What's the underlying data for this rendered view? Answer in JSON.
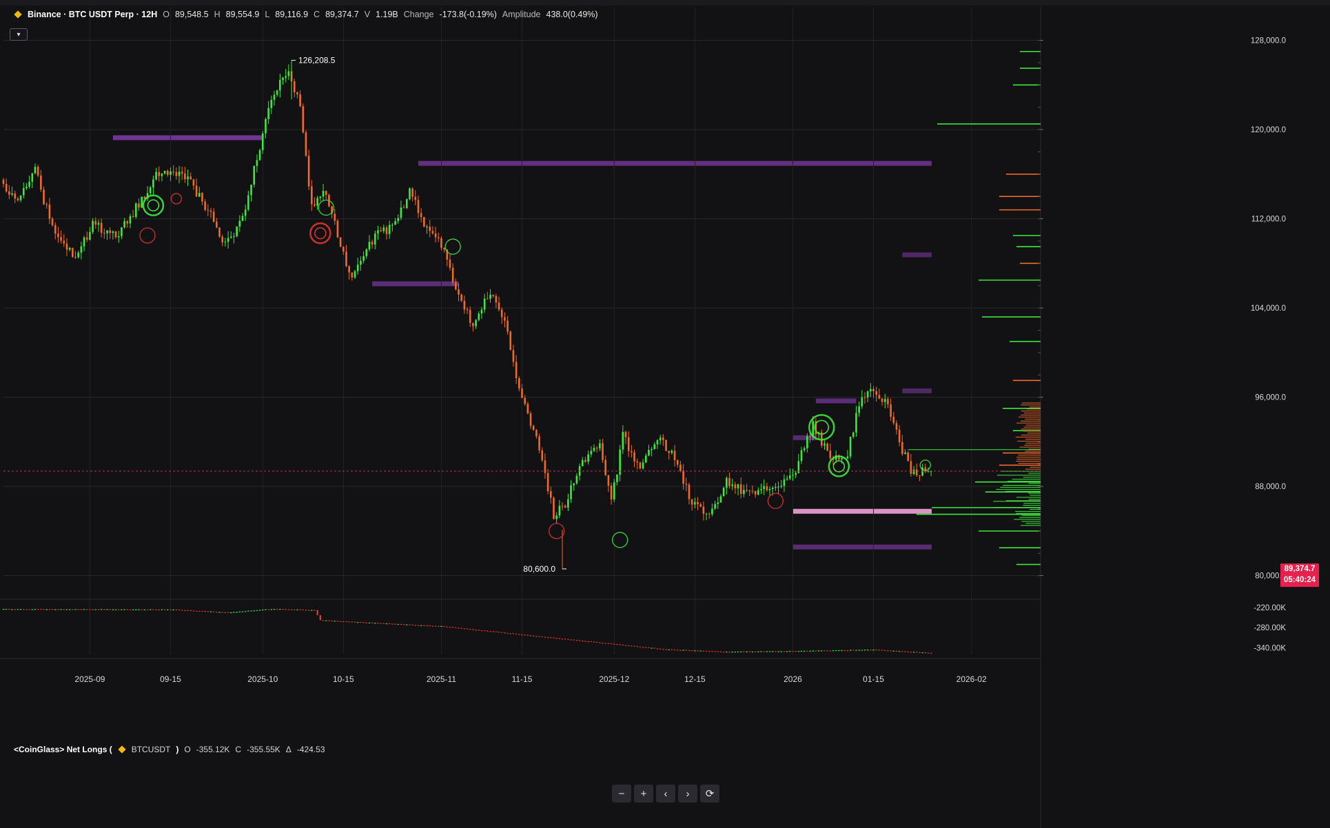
{
  "header": {
    "exchange": "Binance",
    "symbol_title": "Binance · BTC USDT Perp · 12H",
    "open_label": "O",
    "open": "89,548.5",
    "high_label": "H",
    "high": "89,554.9",
    "low_label": "L",
    "low": "89,116.9",
    "close_label": "C",
    "close": "89,374.7",
    "vol_label": "V",
    "volume": "1.19B",
    "change_label": "Change",
    "change": "-173.8(-0.19%)",
    "amplitude_label": "Amplitude",
    "amplitude": "438.0(0.49%)"
  },
  "collapse_icon": "chevron-down-icon",
  "indicator": {
    "title": "<CoinGlass> Net Longs (",
    "symbol": "BTCUSDT",
    "close_paren": ")",
    "o_label": "O",
    "o_value": "-355.12K",
    "c_label": "C",
    "c_value": "-355.55K",
    "delta_label": "Δ",
    "delta_value": "-424.53"
  },
  "price_tag": {
    "price": "89,374.7",
    "countdown": "05:40:24"
  },
  "nav_buttons": [
    {
      "name": "zoom-out-button",
      "icon": "minus-icon",
      "glyph": "−"
    },
    {
      "name": "zoom-in-button",
      "icon": "plus-icon",
      "glyph": "+"
    },
    {
      "name": "scroll-left-button",
      "icon": "chevron-left-icon",
      "glyph": "‹"
    },
    {
      "name": "scroll-right-button",
      "icon": "chevron-right-icon",
      "glyph": "›"
    },
    {
      "name": "reset-button",
      "icon": "refresh-icon",
      "glyph": "⟳"
    }
  ],
  "colors": {
    "background": "#121214",
    "up": "#3ee83e",
    "down": "#f26a2a",
    "heat": "#8a3fb5",
    "heat_hot": "#f3a2d8",
    "last_price": "#e8204d",
    "axis_text": "#d9d9d9"
  },
  "chart_data": [
    {
      "type": "candlestick",
      "title": "BTC USDT Perp · 12H",
      "ylim": [
        78000,
        131000
      ],
      "y_ticks": [
        80000,
        88000,
        96000,
        104000,
        112000,
        120000,
        128000
      ],
      "y_tick_labels": [
        "80,000.0",
        "88,000.0",
        "96,000.0",
        "104,000.0",
        "112,000.0",
        "120,000.0",
        "128,000.0"
      ],
      "x_ticks": [
        "2025-08-17",
        "2025-09-01",
        "2025-09-15",
        "2025-10-01",
        "2025-10-15",
        "2025-11-01",
        "2025-11-15",
        "2025-12-01",
        "2025-12-15",
        "2026-01-01",
        "2026-01-15",
        "2026-02-01"
      ],
      "x_tick_labels": [
        "2025-09",
        "09-15",
        "2025-10",
        "10-15",
        "2025-11",
        "11-15",
        "2025-12",
        "12-15",
        "2026",
        "01-15",
        "2026-02"
      ],
      "x_range": [
        "2025-08-17",
        "2026-02-13"
      ],
      "path": [
        [
          "2025-08-17",
          115500
        ],
        [
          "2025-08-20",
          113500
        ],
        [
          "2025-08-23",
          116500
        ],
        [
          "2025-08-26",
          111000
        ],
        [
          "2025-08-30",
          108400
        ],
        [
          "2025-09-02",
          111500
        ],
        [
          "2025-09-06",
          110500
        ],
        [
          "2025-09-09",
          112500
        ],
        [
          "2025-09-13",
          116000
        ],
        [
          "2025-09-17",
          116200
        ],
        [
          "2025-09-19",
          115200
        ],
        [
          "2025-09-22",
          112800
        ],
        [
          "2025-09-25",
          109500
        ],
        [
          "2025-09-28",
          112000
        ],
        [
          "2025-10-01",
          118500
        ],
        [
          "2025-10-03",
          122500
        ],
        [
          "2025-10-06",
          125500
        ],
        [
          "2025-10-08",
          122000
        ],
        [
          "2025-10-10",
          113000
        ],
        [
          "2025-10-12",
          114800
        ],
        [
          "2025-10-14",
          111500
        ],
        [
          "2025-10-17",
          106500
        ],
        [
          "2025-10-21",
          110500
        ],
        [
          "2025-10-24",
          111200
        ],
        [
          "2025-10-27",
          114500
        ],
        [
          "2025-10-29",
          112000
        ],
        [
          "2025-11-01",
          110200
        ],
        [
          "2025-11-04",
          106000
        ],
        [
          "2025-11-07",
          102500
        ],
        [
          "2025-11-10",
          105500
        ],
        [
          "2025-11-13",
          102000
        ],
        [
          "2025-11-15",
          96500
        ],
        [
          "2025-11-18",
          92500
        ],
        [
          "2025-11-21",
          85500
        ],
        [
          "2025-11-23",
          86500
        ],
        [
          "2025-11-26",
          90500
        ],
        [
          "2025-11-29",
          91500
        ],
        [
          "2025-12-01",
          86500
        ],
        [
          "2025-12-03",
          92500
        ],
        [
          "2025-12-06",
          89500
        ],
        [
          "2025-12-09",
          92500
        ],
        [
          "2025-12-12",
          90500
        ],
        [
          "2025-12-15",
          86500
        ],
        [
          "2025-12-18",
          85500
        ],
        [
          "2025-12-21",
          88500
        ],
        [
          "2025-12-24",
          87500
        ],
        [
          "2025-12-27",
          87500
        ],
        [
          "2025-12-30",
          88000
        ],
        [
          "2026-01-02",
          89500
        ],
        [
          "2026-01-05",
          93500
        ],
        [
          "2026-01-08",
          90500
        ],
        [
          "2026-01-11",
          91000
        ],
        [
          "2026-01-13",
          95500
        ],
        [
          "2026-01-15",
          96500
        ],
        [
          "2026-01-18",
          95200
        ],
        [
          "2026-01-20",
          92000
        ],
        [
          "2026-01-22",
          89200
        ],
        [
          "2026-01-25",
          89375
        ]
      ],
      "annotations": [
        {
          "label": "126,208.5",
          "x": "2025-10-06",
          "y": 126208.5
        },
        {
          "label": "80,600.0",
          "x": "2025-11-22",
          "y": 80600
        }
      ],
      "last_price": 89374.7,
      "liquidity_bands": [
        {
          "y": 117000,
          "from": "2025-10-28",
          "to": "2026-01-31",
          "strength": 0.6
        },
        {
          "y": 119300,
          "from": "2025-09-05",
          "to": "2025-10-01",
          "strength": 0.8
        },
        {
          "y": 106200,
          "from": "2025-10-20",
          "to": "2025-11-04",
          "strength": 0.5
        },
        {
          "y": 95700,
          "from": "2026-01-05",
          "to": "2026-01-12",
          "strength": 0.5
        },
        {
          "y": 92400,
          "from": "2026-01-01",
          "to": "2026-01-05",
          "strength": 0.4
        },
        {
          "y": 85800,
          "from": "2026-01-01",
          "to": "2026-01-31",
          "strength": 1.0
        },
        {
          "y": 82600,
          "from": "2026-01-01",
          "to": "2026-01-31",
          "strength": 0.45
        },
        {
          "y": 96600,
          "from": "2026-01-20",
          "to": "2026-01-31",
          "strength": 0.3
        },
        {
          "y": 108800,
          "from": "2026-01-20",
          "to": "2026-01-31",
          "strength": 0.3
        }
      ],
      "signal_circles": [
        {
          "x": "2025-09-12",
          "y": 113200,
          "kind": "buy",
          "size": 3
        },
        {
          "x": "2025-09-11",
          "y": 110500,
          "kind": "sell",
          "size": 2
        },
        {
          "x": "2025-09-16",
          "y": 113800,
          "kind": "sell",
          "size": 1
        },
        {
          "x": "2025-10-11",
          "y": 110700,
          "kind": "sell",
          "size": 3
        },
        {
          "x": "2025-10-12",
          "y": 113000,
          "kind": "buy",
          "size": 2
        },
        {
          "x": "2025-11-03",
          "y": 109500,
          "kind": "buy",
          "size": 2
        },
        {
          "x": "2025-12-02",
          "y": 83200,
          "kind": "buy",
          "size": 2
        },
        {
          "x": "2025-11-21",
          "y": 84000,
          "kind": "sell",
          "size": 2
        },
        {
          "x": "2026-01-06",
          "y": 93300,
          "kind": "buy",
          "size": 4
        },
        {
          "x": "2026-01-09",
          "y": 89800,
          "kind": "buy",
          "size": 3
        },
        {
          "x": "2025-12-29",
          "y": 86700,
          "kind": "sell",
          "size": 2
        },
        {
          "x": "2026-01-24",
          "y": 89900,
          "kind": "buy",
          "size": 1
        }
      ]
    },
    {
      "type": "bar",
      "title": "<CoinGlass> Net Longs (BTCUSDT)",
      "ylim": [
        -360000,
        -200000
      ],
      "y_ticks": [
        -220000,
        -280000,
        -340000
      ],
      "y_tick_labels": [
        "-220.00K",
        "-280.00K",
        "-340.00K"
      ],
      "path": [
        [
          "2025-08-17",
          -225000
        ],
        [
          "2025-09-15",
          -226000
        ],
        [
          "2025-09-25",
          -235000
        ],
        [
          "2025-10-03",
          -224000
        ],
        [
          "2025-10-10",
          -228000
        ],
        [
          "2025-10-11",
          -258000
        ],
        [
          "2025-10-20",
          -266000
        ],
        [
          "2025-11-01",
          -276000
        ],
        [
          "2025-11-20",
          -310000
        ],
        [
          "2025-12-10",
          -345000
        ],
        [
          "2025-12-20",
          -352000
        ],
        [
          "2026-01-01",
          -350000
        ],
        [
          "2026-01-15",
          -346000
        ],
        [
          "2026-01-25",
          -355550
        ]
      ]
    }
  ],
  "side_profile": [
    {
      "y": 127000,
      "len": 30,
      "side": "buy"
    },
    {
      "y": 125500,
      "len": 30,
      "side": "buy"
    },
    {
      "y": 124000,
      "len": 40,
      "side": "buy"
    },
    {
      "y": 120500,
      "len": 150,
      "side": "buy"
    },
    {
      "y": 116000,
      "len": 50,
      "side": "sell"
    },
    {
      "y": 114000,
      "len": 60,
      "side": "sell"
    },
    {
      "y": 112800,
      "len": 60,
      "side": "sell"
    },
    {
      "y": 110500,
      "len": 40,
      "side": "buy"
    },
    {
      "y": 109500,
      "len": 35,
      "side": "buy"
    },
    {
      "y": 108000,
      "len": 30,
      "side": "sell"
    },
    {
      "y": 106500,
      "len": 90,
      "side": "buy"
    },
    {
      "y": 103200,
      "len": 85,
      "side": "buy"
    },
    {
      "y": 101000,
      "len": 45,
      "side": "buy"
    },
    {
      "y": 97500,
      "len": 40,
      "side": "sell"
    },
    {
      "y": 95000,
      "len": 55,
      "side": "buy"
    },
    {
      "y": 93000,
      "len": 40,
      "side": "buy"
    },
    {
      "y": 91000,
      "len": 55,
      "side": "sell"
    },
    {
      "y": 89900,
      "len": 60,
      "side": "sell"
    },
    {
      "y": 88400,
      "len": 95,
      "side": "buy"
    },
    {
      "y": 87500,
      "len": 80,
      "side": "buy"
    },
    {
      "y": 86700,
      "len": 50,
      "side": "buy"
    },
    {
      "y": 85500,
      "len": 180,
      "side": "buy"
    },
    {
      "y": 84000,
      "len": 90,
      "side": "buy"
    },
    {
      "y": 82500,
      "len": 60,
      "side": "buy"
    },
    {
      "y": 81000,
      "len": 35,
      "side": "buy"
    }
  ]
}
